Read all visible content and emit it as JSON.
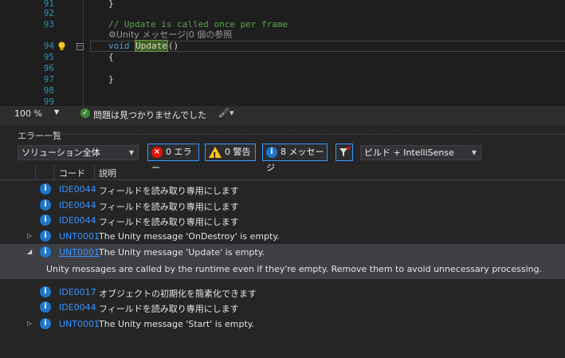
{
  "editor": {
    "lines": [
      {
        "num": "91",
        "text": "}"
      },
      {
        "num": "92",
        "text": ""
      },
      {
        "num": "93",
        "text": "// Update is called once per frame"
      },
      {
        "codelens": "Unity メッセージ|0 個の参照"
      },
      {
        "num": "94",
        "kw": "void",
        "method": "Update",
        "rest": "()"
      },
      {
        "num": "95",
        "text": "{"
      },
      {
        "num": "96",
        "text": ""
      },
      {
        "num": "97",
        "text": "}"
      },
      {
        "num": "98",
        "text": ""
      },
      {
        "num": "99",
        "text": ""
      }
    ]
  },
  "status": {
    "zoom": "100 %",
    "message": "問題は見つかりませんでした"
  },
  "error_list": {
    "title": "エラー一覧",
    "scope": "ソリューション全体",
    "errors_label": "0 エラー",
    "warnings_label": "0 警告",
    "messages_label": "8 メッセージ",
    "source": "ビルド + IntelliSense",
    "col_code": "コード",
    "col_desc": "説明",
    "rows": [
      {
        "code": "IDE0044",
        "desc": "フィールドを読み取り専用にします"
      },
      {
        "code": "IDE0044",
        "desc": "フィールドを読み取り専用にします"
      },
      {
        "code": "IDE0044",
        "desc": "フィールドを読み取り専用にします"
      },
      {
        "code": "UNT0001",
        "desc": "The Unity message 'OnDestroy' is empty."
      },
      {
        "code": "UNT0001",
        "desc": "The Unity message 'Update' is empty."
      },
      {
        "code": "IDE0017",
        "desc": "オブジェクトの初期化を簡素化できます"
      },
      {
        "code": "IDE0044",
        "desc": "フィールドを読み取り専用にします"
      },
      {
        "code": "UNT0001",
        "desc": "The Unity message 'Start' is empty."
      }
    ],
    "detail": "Unity messages are called by the runtime even if they're empty. Remove them to avoid unnecessary processing."
  }
}
